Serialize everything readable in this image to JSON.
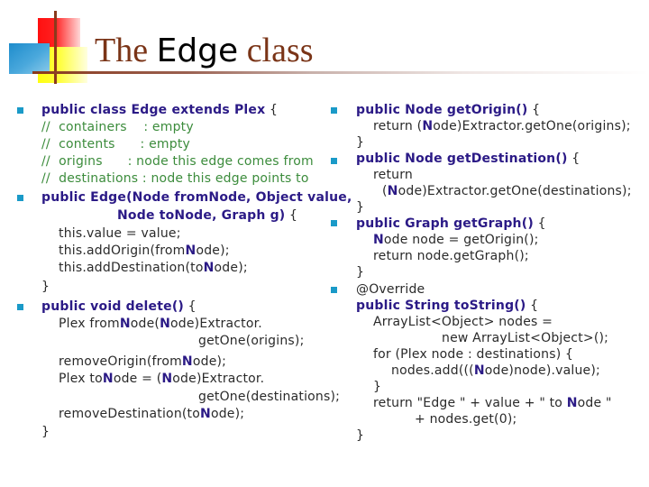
{
  "slide": {
    "title": {
      "prefix": "The ",
      "code": "Edge",
      "suffix": " class"
    },
    "colors": {
      "title": "#7a3417",
      "keyword": "#2b1a86",
      "comment": "#3c8c3c",
      "code": "#2a2a2a",
      "bullet": "#1a9ac8"
    },
    "left_column": {
      "class_decl": "public class Edge extends Plex",
      "brace_open": " {",
      "comments": [
        "//  containers    : empty",
        "//  contents      : empty",
        "//  origins      : node this edge comes from",
        "//  destinations : node this edge points to"
      ],
      "constructor": {
        "line1": "public Edge(Node fromNode, Object value,",
        "line2": "Node toNode, Graph g)",
        "brace": " {",
        "body": [
          {
            "pre": "this.value = value;",
            "n": "",
            "post": ""
          },
          {
            "pre": "this.addOrigin(from",
            "n": "N",
            "post": "ode);"
          },
          {
            "pre": "this.addDestination(to",
            "n": "N",
            "post": "ode);"
          }
        ],
        "close": "}"
      },
      "delete_method": {
        "signature": "public void delete()",
        "brace": " {",
        "body": [
          {
            "pre": "Plex from",
            "n": "N",
            "mid": "ode(",
            "n2": "N",
            "post": "ode)Extractor."
          },
          {
            "pre": "getOne(origins);"
          },
          {
            "pre": "removeOrigin(from",
            "n": "N",
            "post": "ode);"
          },
          {
            "pre": "Plex to",
            "n": "N",
            "mid": "ode = (",
            "n2": "N",
            "post": "ode)Extractor."
          },
          {
            "pre": "getOne(destinations);"
          },
          {
            "pre": "removeDestination(to",
            "n": "N",
            "post": "ode);"
          }
        ],
        "close": "}"
      }
    },
    "right_column": {
      "get_origin": {
        "signature": "public Node getOrigin()",
        "brace": " {",
        "body_pre": "return (",
        "body_n": "N",
        "body_post": "ode)Extractor.getOne(origins);",
        "close": "}"
      },
      "get_destination": {
        "signature": "public Node getDestination()",
        "brace": " {",
        "body1": "return",
        "body2_pre": "(",
        "body2_n": "N",
        "body2_post": "ode)Extractor.getOne(destinations);",
        "close": "}"
      },
      "get_graph": {
        "signature": "public Graph getGraph()",
        "brace": " {",
        "body1_n": "N",
        "body1_post": "ode node = getOrigin();",
        "body2": "return node.getGraph();",
        "close": "}"
      },
      "to_string": {
        "annotation": "@Override",
        "signature": "public String toString()",
        "brace": " {",
        "body": [
          "ArrayList<Object> nodes =",
          "new ArrayList<Object>();",
          "for (Plex node : destinations) {"
        ],
        "add_pre": "nodes.add(((",
        "add_n": "N",
        "add_post": "ode)node).value);",
        "for_close": "}",
        "return_pre": "return \"Edge \" + value + \" to ",
        "return_n": "N",
        "return_post": "ode \"",
        "return_cont": "+ nodes.get(0);",
        "close": "}"
      }
    }
  }
}
